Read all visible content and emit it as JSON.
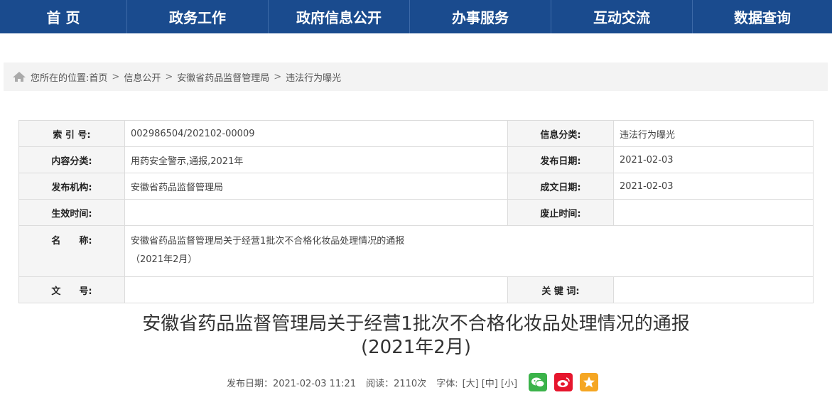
{
  "nav": [
    {
      "label": "首 页",
      "w": 179
    },
    {
      "label": "政务工作",
      "w": 199
    },
    {
      "label": "政府信息公开",
      "w": 199
    },
    {
      "label": "办事服务",
      "w": 199
    },
    {
      "label": "互动交流",
      "w": 199
    },
    {
      "label": "数据查询",
      "w": 196
    }
  ],
  "breadcrumb": {
    "prefix": "您所在的位置:",
    "items": [
      "首页",
      "信息公开",
      "安徽省药品监督管理局",
      "违法行为曝光"
    ]
  },
  "meta": {
    "index_label": "索 引 号:",
    "index_value": "002986504/202102-00009",
    "category_label": "信息分类:",
    "category_value": "违法行为曝光",
    "content_label": "内容分类:",
    "content_value": "用药安全警示,通报,2021年",
    "pubdate_label": "发布日期:",
    "pubdate_value": "2021-02-03",
    "org_label": "发布机构:",
    "org_value": "安徽省药品监督管理局",
    "created_label": "成文日期:",
    "created_value": "2021-02-03",
    "effective_label": "生效时间:",
    "effective_value": "",
    "expire_label": "废止时间:",
    "expire_value": "",
    "name_label": "名　　称:",
    "name_value_line1": "安徽省药品监督管理局关于经营1批次不合格化妆品处理情况的通报",
    "name_value_line2": "（2021年2月）",
    "docno_label": "文　　号:",
    "docno_value": "",
    "keyword_label": "关 键 词:",
    "keyword_value": ""
  },
  "article": {
    "title_line1": "安徽省药品监督管理局关于经营1批次不合格化妆品处理情况的通报",
    "title_line2": "(2021年2月)",
    "publish": "发布日期：2021-02-03 11:21",
    "reads": "阅读：2110次",
    "font_label": "字体:",
    "font_large": "[大]",
    "font_medium": "[中]",
    "font_small": "[小]"
  },
  "colors": {
    "nav_bg": "#1a4b8e",
    "wechat": "#3bb34a",
    "weibo": "#e6162d",
    "qzone": "#f5a623"
  }
}
